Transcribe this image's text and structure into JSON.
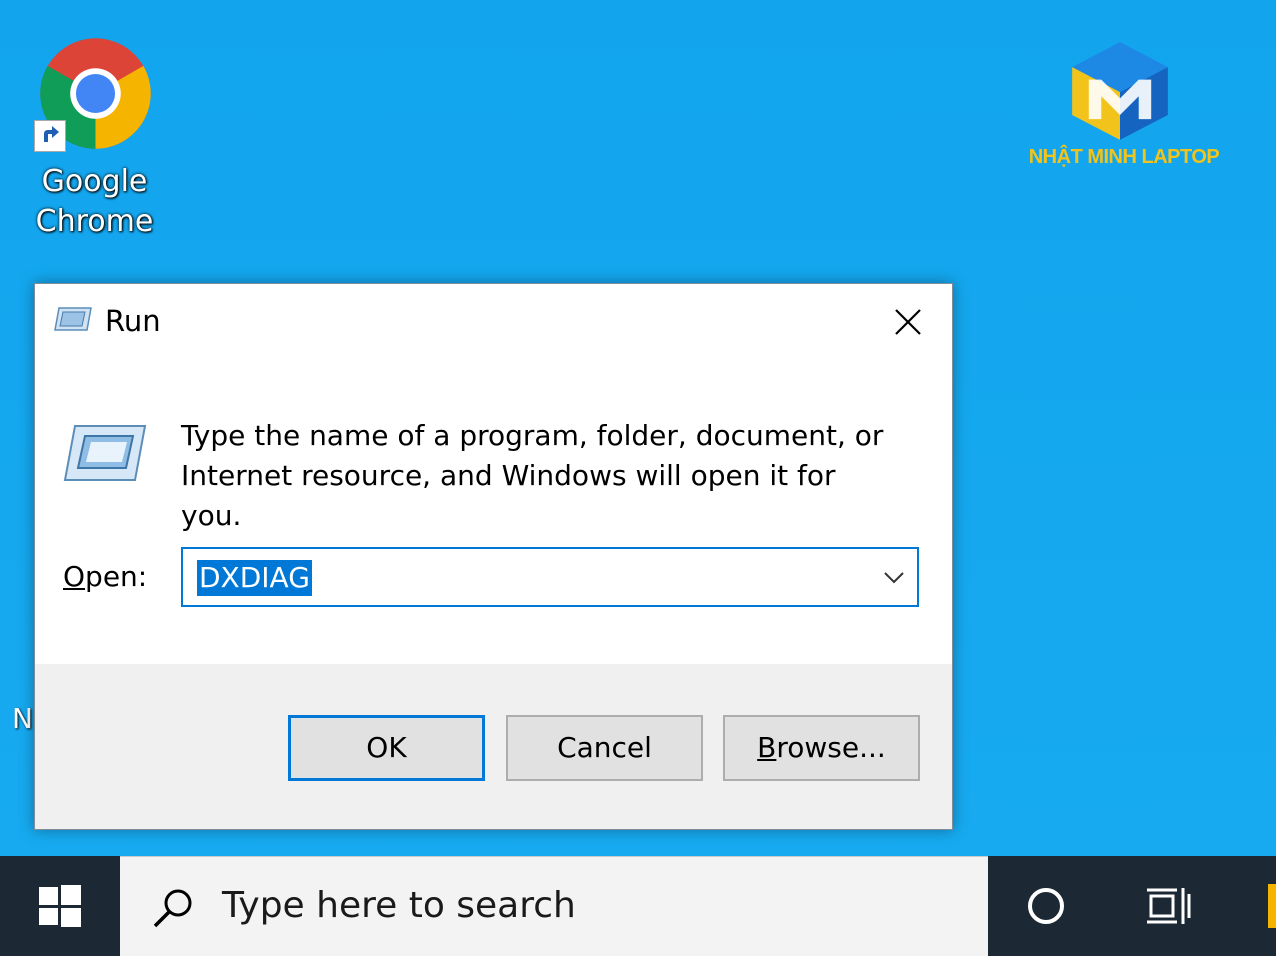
{
  "desktop": {
    "icons": [
      {
        "label_line1": "Google",
        "label_line2": "Chrome"
      }
    ],
    "partial_label": "N",
    "brand": {
      "name": "NHẬT MINH LAPTOP"
    }
  },
  "run_dialog": {
    "title": "Run",
    "description_line1": "Type the name of a program, folder, document, or",
    "description_line2": "Internet resource, and Windows will open it for you.",
    "open_label_accel": "O",
    "open_label_rest": "pen:",
    "open_value": "DXDIAG",
    "buttons": {
      "ok": "OK",
      "cancel": "Cancel",
      "browse_accel": "B",
      "browse_rest": "rowse..."
    }
  },
  "taskbar": {
    "search_placeholder": "Type here to search"
  },
  "colors": {
    "desktop_bg": "#14a6ec",
    "accent": "#0078d7",
    "taskbar": "#1c2833",
    "brand_yellow": "#f2c31a",
    "brand_blue": "#1565c0"
  }
}
